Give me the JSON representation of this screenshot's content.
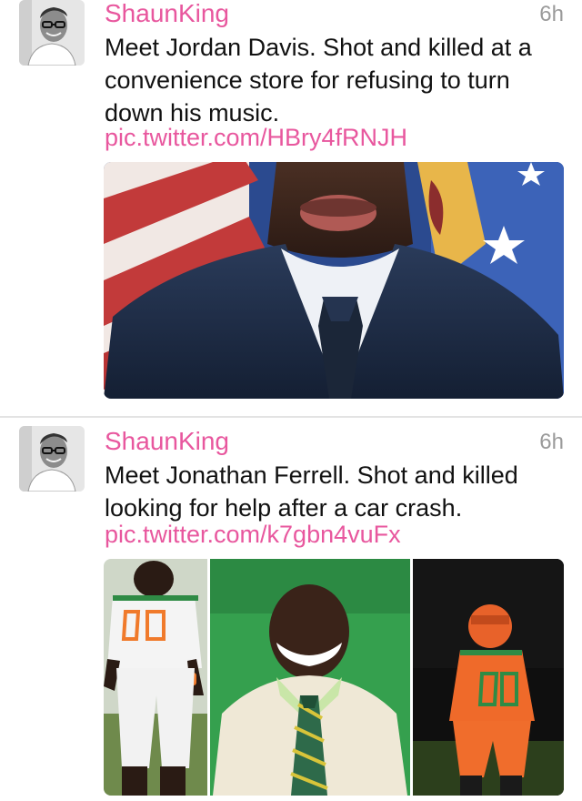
{
  "tweets": [
    {
      "user_name": "ShaunKing",
      "timestamp": "6h",
      "text": "Meet Jordan Davis. Shot and killed at a convenience store for refusing to turn down his music.",
      "link": "pic.twitter.com/HBry4fRNJH"
    },
    {
      "user_name": "ShaunKing",
      "timestamp": "6h",
      "text": "Meet Jonathan Ferrell. Shot and killed looking for help after a car crash.",
      "link": "pic.twitter.com/k7gbn4vuFx"
    }
  ],
  "colors": {
    "accent": "#e8579e",
    "timestamp": "#9a9a9a",
    "text": "#111111",
    "divider": "#e3e3e3"
  }
}
